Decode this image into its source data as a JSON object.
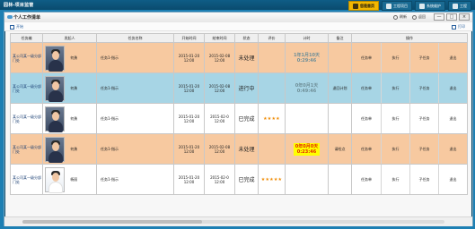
{
  "app": {
    "title": "园林-项目监管"
  },
  "topnav": [
    {
      "label": "您是首页",
      "active": true
    },
    {
      "label": "工程项目",
      "active": false
    },
    {
      "label": "系统维护",
      "active": false
    },
    {
      "label": "工程",
      "active": false
    }
  ],
  "window": {
    "title": "个人工作清单",
    "actions": {
      "refresh": "刷新",
      "back": "返回"
    },
    "controls": {
      "minimize": "—",
      "maximize": "□",
      "close": "×"
    }
  },
  "toolbar": {
    "add": "开始",
    "print": "打印"
  },
  "table": {
    "columns": [
      "任务编",
      "发起人",
      "任务名称",
      "开始时间",
      "结束时间",
      "状态",
      "评价",
      "计时",
      "备注",
      "操作"
    ],
    "op_labels": [
      "任务单",
      "执行",
      "子任务",
      "退出"
    ],
    "rows": [
      {
        "style": "orange",
        "task_no": "某公司某一级分部门处",
        "person": "何勇",
        "avatar": "male",
        "task_name": "任务1-指示",
        "start": "2015-01-20 12:00",
        "end": "2015-02-08 12:00",
        "status": "未处理",
        "rating": "",
        "timer_line1": "1年1月10天",
        "timer_line2": "0:29:46",
        "timer_style": "gray",
        "note": ""
      },
      {
        "style": "blue",
        "task_no": "某公司某一级分部门处",
        "person": "何勇",
        "avatar": "male",
        "task_name": "任务1-指示",
        "start": "2015-01-20 12:00",
        "end": "2015-02-08 12:00",
        "status": "进行中",
        "rating": "",
        "timer_line1": "0年0月1天",
        "timer_line2": "0:49:46",
        "timer_style": "gray",
        "note": "退回计划"
      },
      {
        "style": "white",
        "task_no": "某公司某一级分部门处",
        "person": "何勇",
        "avatar": "male",
        "task_name": "任务1-指示",
        "start": "2015-01-20 12:00",
        "end": "2015-02-0 12:00",
        "status": "已完成",
        "rating": "★★★★",
        "timer_line1": "",
        "timer_line2": "",
        "timer_style": "",
        "note": ""
      },
      {
        "style": "orange",
        "task_no": "某公司某一级分部门处",
        "person": "何勇",
        "avatar": "male",
        "task_name": "任务1-指示",
        "start": "2015-01-20 12:00",
        "end": "2015-02-08 12:00",
        "status": "未处理",
        "rating": "",
        "timer_line1": "0年0月0天",
        "timer_line2": "0:23:46",
        "timer_style": "yellow",
        "note": "请检点"
      },
      {
        "style": "white",
        "task_no": "某公司某一级分部门处",
        "person": "杨丽",
        "avatar": "female",
        "task_name": "任务1-指示",
        "start": "2015-01-20 12:00",
        "end": "2015-02-0 12:00",
        "status": "已完成",
        "rating": "★★★★★",
        "timer_line1": "",
        "timer_line2": "",
        "timer_style": "",
        "note": ""
      }
    ]
  }
}
